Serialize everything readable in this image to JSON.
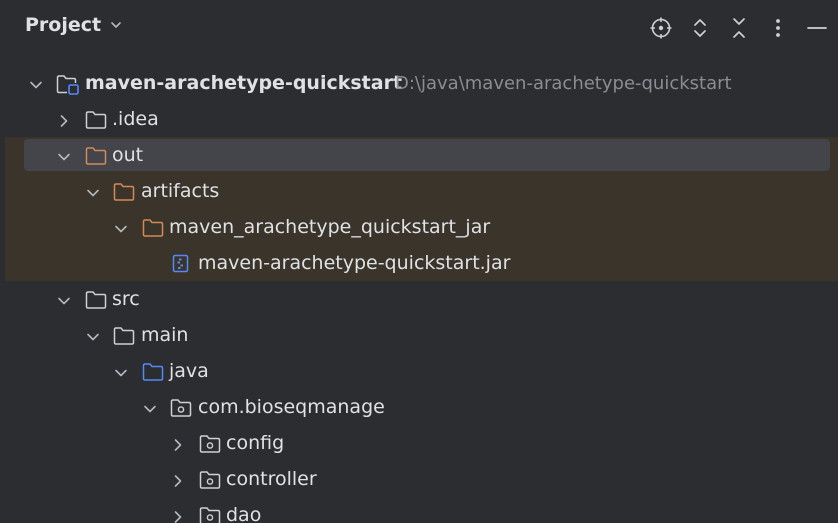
{
  "header": {
    "title": "Project",
    "icons": [
      "locate-icon",
      "expand-all-icon",
      "collapse-all-icon",
      "more-options-icon",
      "minimize-icon"
    ]
  },
  "tree": {
    "items": [
      {
        "label": "maven-arachetype-quickstart",
        "path": "D:\\java\\maven-arachetype-quickstart",
        "icon": "module-folder-icon",
        "expanded": true
      },
      {
        "label": ".idea",
        "icon": "folder-icon",
        "expanded": false
      },
      {
        "label": "out",
        "icon": "excluded-folder-icon",
        "expanded": true,
        "selected": true
      },
      {
        "label": "artifacts",
        "icon": "excluded-folder-icon",
        "expanded": true
      },
      {
        "label": "maven_arachetype_quickstart_jar",
        "icon": "excluded-folder-icon",
        "expanded": true
      },
      {
        "label": "maven-arachetype-quickstart.jar",
        "icon": "jar-file-icon"
      },
      {
        "label": "src",
        "icon": "folder-icon",
        "expanded": true
      },
      {
        "label": "main",
        "icon": "folder-icon",
        "expanded": true
      },
      {
        "label": "java",
        "icon": "source-folder-icon",
        "expanded": true
      },
      {
        "label": "com.bioseqmanage",
        "icon": "package-icon",
        "expanded": true
      },
      {
        "label": "config",
        "icon": "package-icon",
        "expanded": false
      },
      {
        "label": "controller",
        "icon": "package-icon",
        "expanded": false
      },
      {
        "label": "dao",
        "icon": "package-icon",
        "expanded": false
      }
    ]
  },
  "colors": {
    "background": "#2b2d30",
    "selection": "#43454a",
    "excluded_background": "#3a342a",
    "excluded_folder": "#d38a56",
    "source_folder": "#548af7",
    "text": "#dfe1e5",
    "secondary_text": "#8a8d92"
  }
}
